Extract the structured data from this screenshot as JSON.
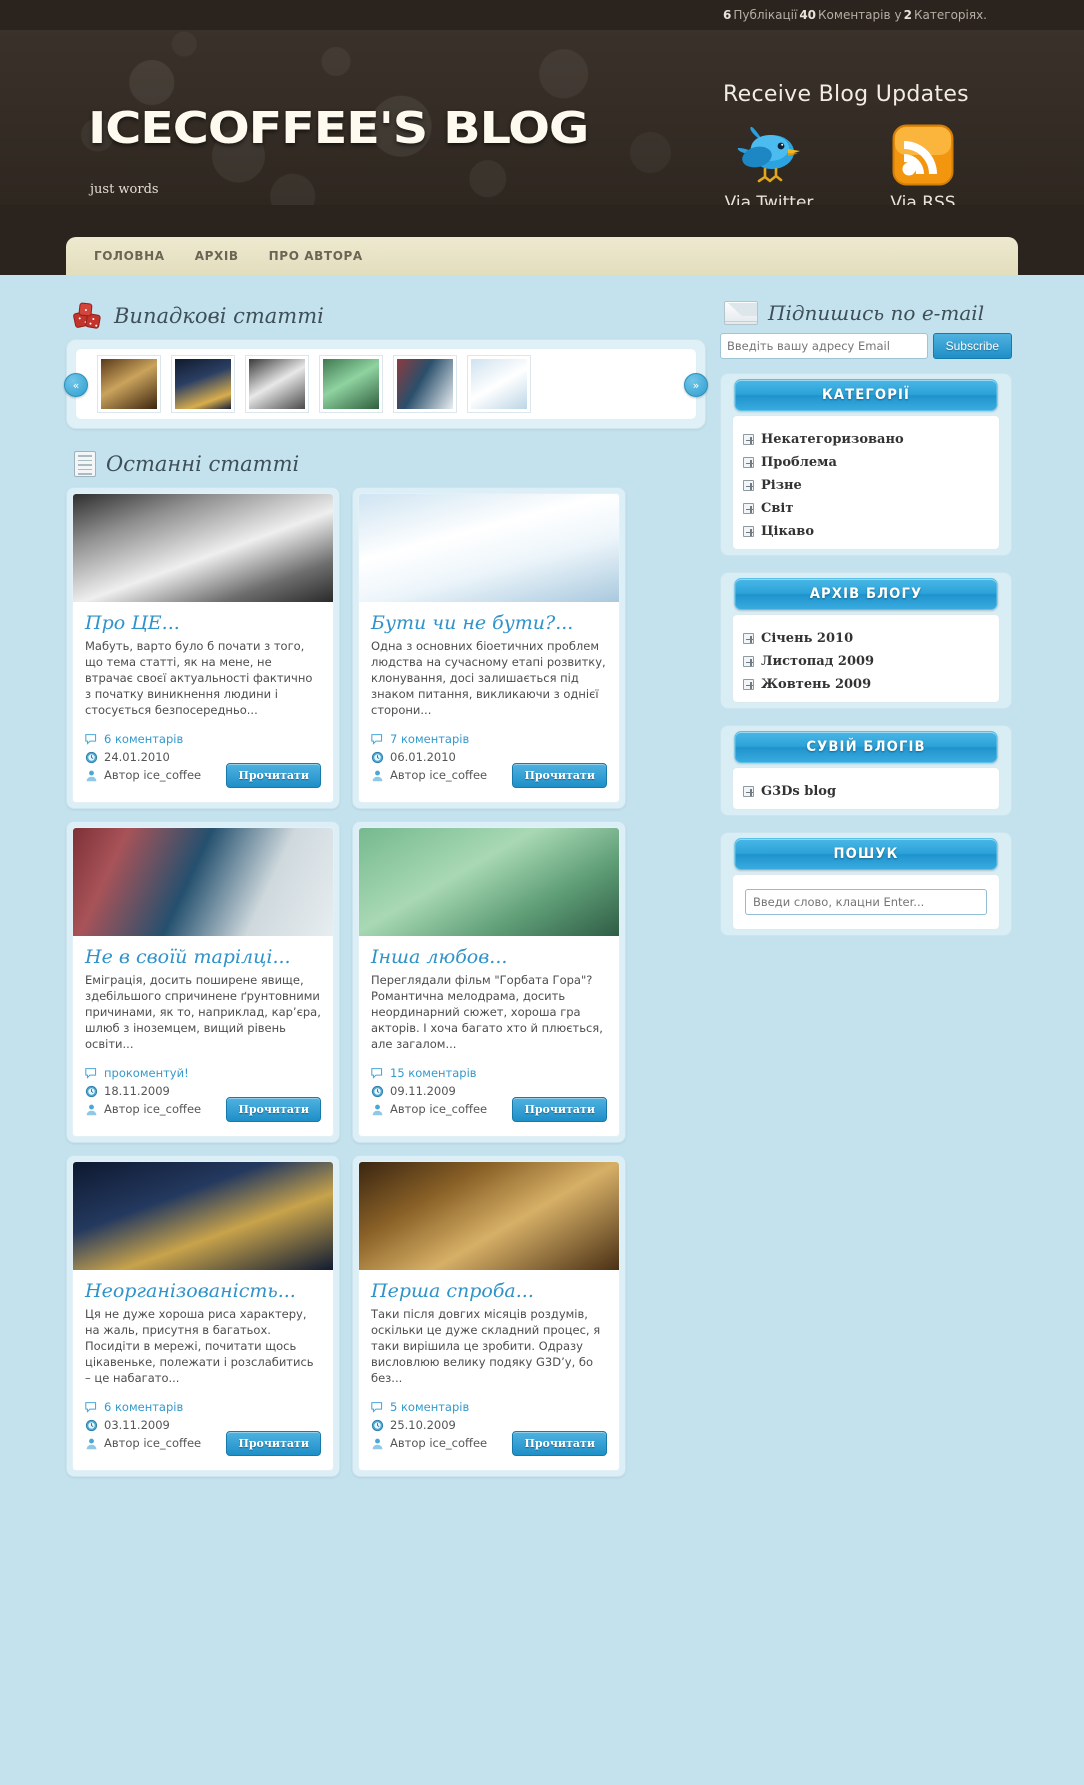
{
  "topbar": {
    "posts_count": "6",
    "posts_label": "Публікації",
    "comments_count": "40",
    "comments_label": "Коментарів",
    "in_label": "у",
    "categories_count": "2",
    "categories_label": "Категоріях."
  },
  "header": {
    "logo": "ICECOFFEE'S BLOG",
    "tagline": "just words",
    "updates_title": "Receive Blog Updates",
    "twitter_label": "Via Twitter",
    "rss_label": "Via RSS"
  },
  "nav": {
    "items": [
      {
        "label": "ГОЛОВНА"
      },
      {
        "label": "АРХІВ"
      },
      {
        "label": "ПРО АВТОРА"
      }
    ]
  },
  "random": {
    "heading": "Випадкові статті",
    "prev": "«",
    "next": "»",
    "thumbs": [
      {
        "name": "thumb-flowers",
        "colors": "linear-gradient(150deg,#5a3a1b,#caa35c 45%,#3d2610)"
      },
      {
        "name": "thumb-clock",
        "colors": "linear-gradient(160deg,#101a2e,#2b3f63 40%,#d8ad4d 78%,#16203a)"
      },
      {
        "name": "thumb-woman",
        "colors": "linear-gradient(150deg,#3a3a3a,#e8e8e8 48%,#4a4a4a)"
      },
      {
        "name": "thumb-hands",
        "colors": "linear-gradient(150deg,#3f7a52,#8fd3a0 45%,#2f5f3e)"
      },
      {
        "name": "thumb-rain",
        "colors": "linear-gradient(120deg,#8c3b3e,#2a4f6b 42%,#e9eef2)"
      },
      {
        "name": "thumb-kittens",
        "colors": "linear-gradient(150deg,#cfe2ef,#ffffff 50%,#bcd6e6)"
      }
    ]
  },
  "latest": {
    "heading": "Останні статті"
  },
  "posts": [
    {
      "title": "Про ЦЕ...",
      "excerpt": "Мабуть, варто було б почати з того, що тема статті, як на мене, не втрачає своєї актуальності фактично з початку виникнення людини і стосується безпосередньо...",
      "comments": "6 коментарів",
      "date": "24.01.2010",
      "author": "Автор ice_coffee",
      "read": "Прочитати",
      "image": "linear-gradient(160deg,#2e2e2e 0%,#8f8f8f 25%,#efefef 55%,#6d6d6d 80%,#2a2a2a 100%)"
    },
    {
      "title": "Бути чи не бути?...",
      "excerpt": "Одна з основних біоетичних проблем людства на сучасному етапі розвитку, клонування, досі залишається під знаком питання, викликаючи з однієї сторони...",
      "comments": "7 коментарів",
      "date": "06.01.2010",
      "author": "Автор ice_coffee",
      "read": "Прочитати",
      "image": "linear-gradient(165deg,#cfe4f2 0%,#ffffff 38%,#eef6fb 62%,#a9c9de 100%)"
    },
    {
      "title": "Не в своїй тарілці...",
      "excerpt": "Еміграція, досить поширене явище, здебільшого спричинене ґрунтовними причинами, як то, наприклад, кар’єра, шлюб з іноземцем, вищий рівень освіти...",
      "comments": "прокоментуй!",
      "date": "18.11.2009",
      "author": "Автор ice_coffee",
      "read": "Прочитати",
      "image": "linear-gradient(115deg,#7e3137 0%,#a85358 18%,#24506e 45%,#cfd9dd 72%,#e7edf1 100%)"
    },
    {
      "title": "Інша любов...",
      "excerpt": "Переглядали фільм \"Горбата Гора\"? Романтична мелодрама, досить неординарний сюжет, хороша гра акторів. І хоча багато хто й плюється, але загалом...",
      "comments": "15 коментарів",
      "date": "09.11.2009",
      "author": "Автор ice_coffee",
      "read": "Прочитати",
      "image": "linear-gradient(150deg,#76b98f 0%,#a8d9b4 40%,#5f9e77 70%,#2f5d45 100%)"
    },
    {
      "title": "Неорганізованість...",
      "excerpt": "Ця не дуже хороша риса характеру, на жаль, присутня в багатьох. Посидіти в мережі, почитати щось цікавеньке, полежати і розслабитись – це набагато...",
      "comments": "6 коментарів",
      "date": "03.11.2009",
      "author": "Автор ice_coffee",
      "read": "Прочитати",
      "image": "linear-gradient(160deg,#0d1830 0%,#24395f 35%,#c8a34b 62%,#101b33 100%)"
    },
    {
      "title": "Перша спроба...",
      "excerpt": "Таки після довгих місяців роздумів, оскільки це дуже складний процес, я таки вирішила це зробити. Одразу висловлюю велику подяку G3D’у, бо без...",
      "comments": "5 коментарів",
      "date": "25.10.2009",
      "author": "Автор ice_coffee",
      "read": "Прочитати",
      "image": "linear-gradient(150deg,#3a2611 0%,#8a6127 30%,#d7b067 58%,#4a3015 100%)"
    }
  ],
  "sidebar": {
    "subscribe": {
      "heading": "Підпишись по e-mail",
      "placeholder": "Введіть вашу адресу Email",
      "value": "",
      "button": "Subscribe"
    },
    "widgets": [
      {
        "title": "КАТЕГОРІЇ",
        "items": [
          {
            "label": "Некатегоризовано"
          },
          {
            "label": "Проблема"
          },
          {
            "label": "Різне"
          },
          {
            "label": "Світ"
          },
          {
            "label": "Цікаво"
          }
        ]
      },
      {
        "title": "АРХІВ БЛОГУ",
        "items": [
          {
            "label": "Січень 2010"
          },
          {
            "label": "Листопад 2009"
          },
          {
            "label": "Жовтень 2009"
          }
        ]
      },
      {
        "title": "СУВІЙ БЛОГІВ",
        "items": [
          {
            "label": "G3Ds blog"
          }
        ]
      }
    ],
    "search": {
      "title": "ПОШУК",
      "placeholder": "Введи слово, клацни Enter...",
      "value": ""
    }
  },
  "colors": {
    "page_bg": "#c3e2ee",
    "header_bg": "#2e2720",
    "nav_bg": "#e8e3c6",
    "accent_blue": "#2ba2d8",
    "title_blue": "#2f93c9"
  }
}
